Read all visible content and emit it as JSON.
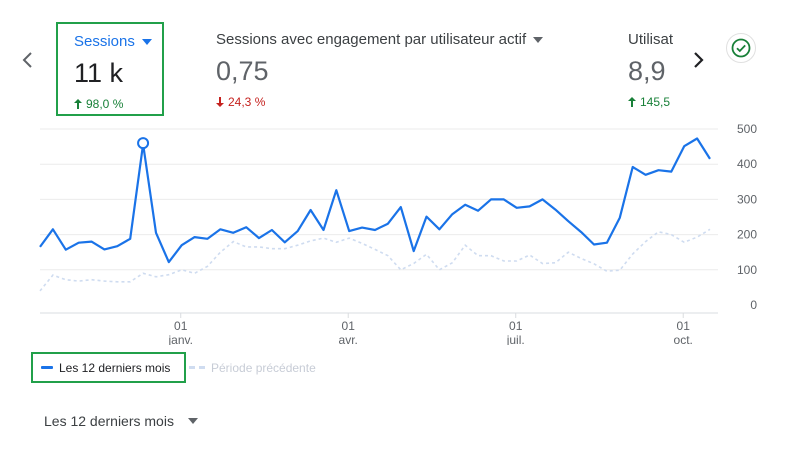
{
  "metrics": [
    {
      "label": "Sessions",
      "value": "11 k",
      "delta": "98,0 %",
      "direction": "up",
      "selected": true
    },
    {
      "label": "Sessions avec engagement par utilisateur actif",
      "value": "0,75",
      "delta": "24,3 %",
      "direction": "down",
      "selected": false
    },
    {
      "label": "Utilisat",
      "value": "8,9",
      "delta": "145,5",
      "direction": "up",
      "selected": false
    }
  ],
  "icons": {
    "prev": "chevron-left-icon",
    "next": "chevron-right-icon",
    "dropdown": "caret-down-icon",
    "status": "check-circle-icon"
  },
  "colors": {
    "accent": "#1a73e8",
    "up": "#188038",
    "down": "#c5221f",
    "highlight_border": "#21a04a",
    "previous_series": "#cfdcf0"
  },
  "chart_data": {
    "type": "line",
    "y_ticks": [
      "500",
      "400",
      "300",
      "200",
      "100",
      "0"
    ],
    "x_ticks": [
      {
        "day": "01",
        "month": "janv."
      },
      {
        "day": "01",
        "month": "avr."
      },
      {
        "day": "01",
        "month": "juil."
      },
      {
        "day": "01",
        "month": "oct."
      }
    ],
    "ylim": [
      0,
      500
    ],
    "grid": true,
    "series": [
      {
        "name": "Les 12 derniers mois",
        "values": [
          165,
          215,
          157,
          177,
          180,
          158,
          167,
          188,
          457,
          205,
          122,
          170,
          193,
          188,
          215,
          205,
          221,
          190,
          213,
          178,
          210,
          270,
          213,
          326,
          210,
          220,
          213,
          231,
          278,
          153,
          251,
          215,
          258,
          285,
          268,
          300,
          300,
          276,
          280,
          300,
          271,
          238,
          207,
          172,
          177,
          248,
          392,
          370,
          383,
          379,
          451,
          473,
          415
        ],
        "highlight_index": 8
      },
      {
        "name": "Période précédente",
        "values": [
          40,
          85,
          72,
          68,
          72,
          68,
          66,
          66,
          90,
          80,
          86,
          100,
          90,
          110,
          150,
          180,
          165,
          165,
          160,
          160,
          170,
          182,
          190,
          178,
          190,
          175,
          158,
          140,
          100,
          118,
          144,
          100,
          120,
          170,
          140,
          140,
          125,
          125,
          142,
          118,
          120,
          150,
          132,
          117,
          96,
          99,
          145,
          180,
          208,
          200,
          178,
          193,
          215
        ]
      }
    ]
  },
  "legend": {
    "current": "Les 12 derniers mois",
    "previous": "Période précédente"
  },
  "period_selector": {
    "label": "Les 12 derniers mois"
  }
}
